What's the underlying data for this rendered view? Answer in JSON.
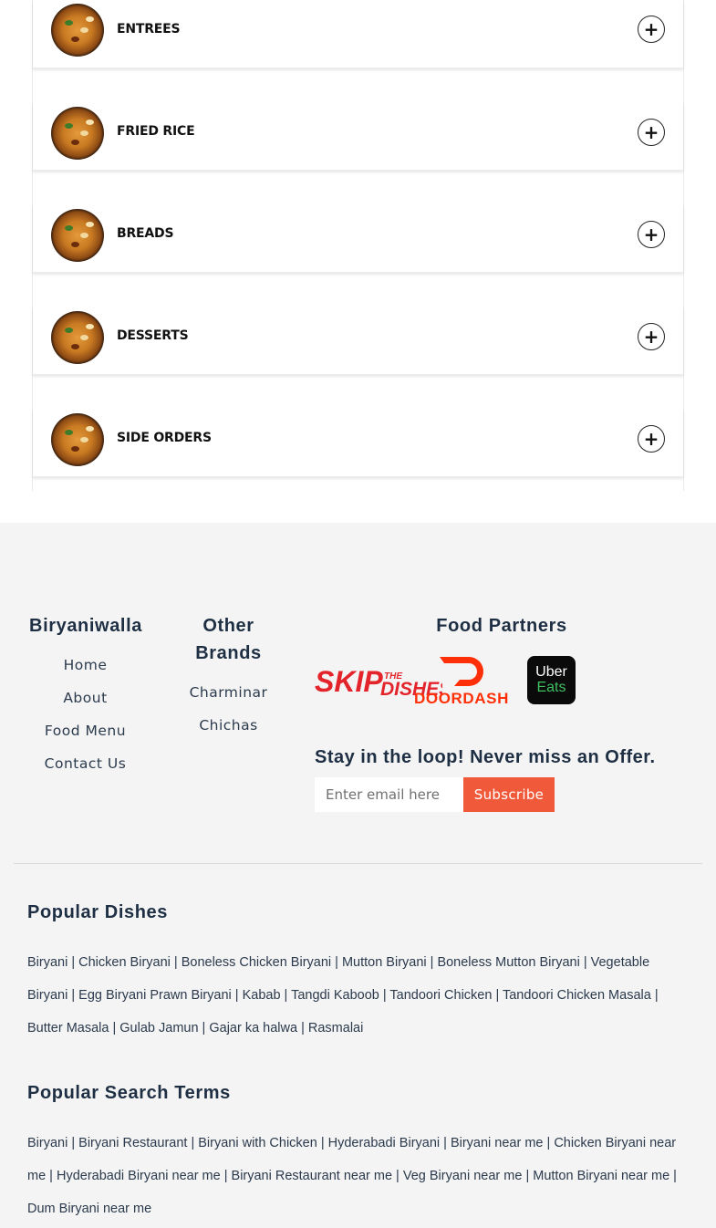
{
  "menu": {
    "items": [
      {
        "label": "ENTREES"
      },
      {
        "label": "FRIED RICE"
      },
      {
        "label": "BREADS"
      },
      {
        "label": "DESSERTS"
      },
      {
        "label": "SIDE ORDERS"
      }
    ],
    "expand_glyph": "+",
    "expand_icon": "plus-circle-icon",
    "thumb_icon": "biryani-dish-image"
  },
  "footer": {
    "brand": {
      "title": "Biryaniwalla",
      "links": [
        "Home",
        "About",
        "Food Menu",
        "Contact Us"
      ]
    },
    "other_brands": {
      "title_line1": "Other",
      "title_line2": "Brands",
      "links": [
        "Charminar",
        "Chichas"
      ]
    },
    "partners": {
      "title": "Food Partners",
      "logos": [
        "SKIP THE DISHES",
        "DOORDASH",
        "Uber Eats"
      ],
      "skip_text": "SKIP",
      "skip_sub": "THE",
      "skip_sub2": "DISHES",
      "doordash_text": "DOORDASH",
      "uber_line1": "Uber",
      "uber_line2": "Eats"
    },
    "newsletter": {
      "title": "Stay in the loop! Never miss an Offer.",
      "placeholder": "Enter email here",
      "button": "Subscribe"
    },
    "popular_dishes": {
      "title": "Popular Dishes",
      "text": "Biryani | Chicken Biryani | Boneless Chicken Biryani | Mutton Biryani | Boneless Mutton Biryani | Vegetable Biryani | Egg Biryani Prawn Biryani | Kabab | Tangdi Kaboob | Tandoori Chicken | Tandoori Chicken Masala | Butter Masala | Gulab Jamun | Gajar ka halwa | Rasmalai"
    },
    "popular_search": {
      "title": "Popular Search Terms",
      "text": "Biryani | Biryani Restaurant | Biryani with Chicken | Hyderabadi Biryani | Biryani near me | Chicken Biryani near me | Hyderabadi Biryani near me | Biryani Restaurant near me | Veg Biryani near me | Mutton Biryani near me | Dum Biryani near me"
    }
  },
  "colors": {
    "accent": "#f05a3b",
    "heading": "#1e2f44",
    "footer_bg": "#f4f4f4",
    "skip_red": "#e3242b",
    "doordash_red": "#ff3008",
    "uber_green": "#3fc060"
  }
}
